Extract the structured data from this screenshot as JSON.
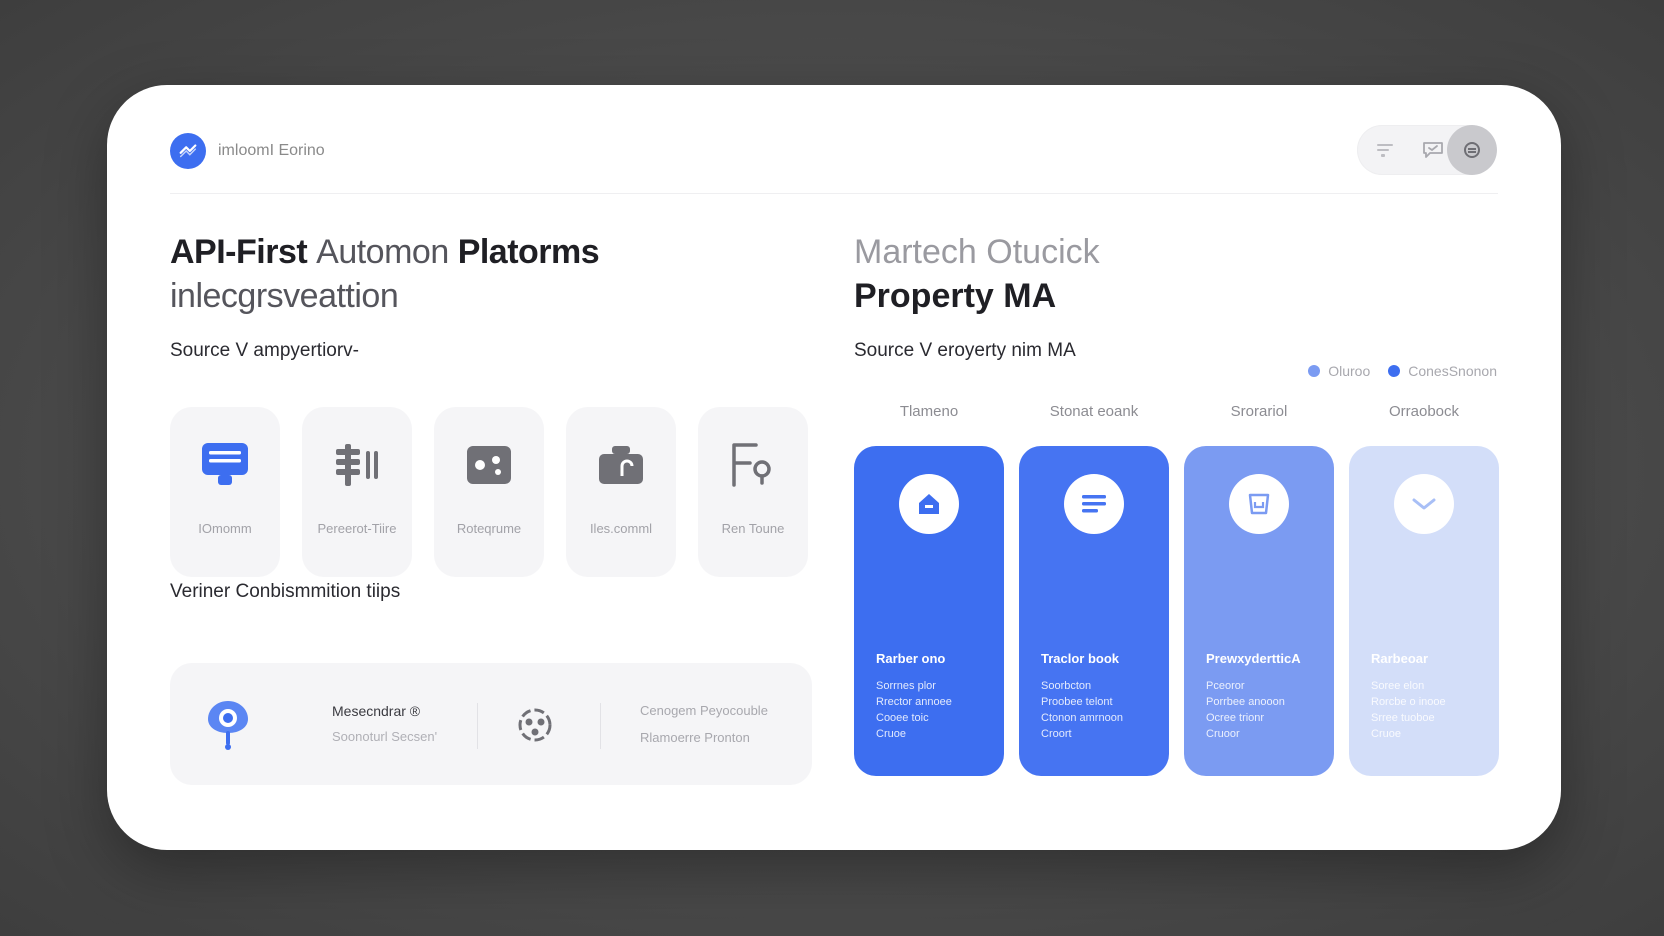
{
  "header": {
    "brand_name": "imloomI Eorino",
    "actions": [
      "list-icon",
      "shield-chat-icon",
      "settings-icon"
    ]
  },
  "left": {
    "title_bold1": "API-First",
    "title_light": "Automon",
    "title_bold2": "Platorms",
    "title_line2": "inlecgrsveattion",
    "source_label": "Source V ampyertiorv-",
    "tiles": [
      {
        "label": "IOmomm",
        "icon": "chat-card-icon",
        "color": "#3d6ef0"
      },
      {
        "label": "Pereerot-Tiire",
        "icon": "server-bars-icon",
        "color": "#707076"
      },
      {
        "label": "Roteqrume",
        "icon": "photo-icon",
        "color": "#707076"
      },
      {
        "label": "Iles.comml",
        "icon": "briefcase-icon",
        "color": "#707076"
      },
      {
        "label": "Ren Toune",
        "icon": "file-search-icon",
        "color": "#707076"
      }
    ],
    "tips_label": "Veriner Conbismmition tiips",
    "tips": {
      "item1_title": "Mesecndrar ®",
      "item1_sub": "Soonoturl Secsen'",
      "item2_title": "Cenogem Peyocouble",
      "item2_sub": "Rlamoerre Pronton"
    }
  },
  "right": {
    "title_line1": "Martech Otucick",
    "title_line2": "Property MA",
    "source_label": "Source V eroyerty nim MA",
    "legend": [
      {
        "label": "Oluroo",
        "color": "#7b9bf2"
      },
      {
        "label": "ConesSnonon",
        "color": "#3d6ef0"
      }
    ],
    "columns": [
      {
        "header": "Tlameno",
        "title": "Rarber ono",
        "icon": "home-icon",
        "color": "#3d6ef0",
        "lines": [
          "Sorrnes plor",
          "Rrector annoee",
          "Cooee toic",
          "Cruoe"
        ]
      },
      {
        "header": "Stonat eoank",
        "title": "Traclor book",
        "icon": "lines-icon",
        "color": "#4674f2",
        "lines": [
          "Soorbcton",
          "Proobee telont",
          "Ctonon amrnoon",
          "Croort"
        ]
      },
      {
        "header": "Srorariol",
        "title": "PrewxydertticA",
        "icon": "cup-icon",
        "color": "#7b9bf2",
        "lines": [
          "Pceoror",
          "Porrbee anooon",
          "Ocree trionr",
          "Cruoor"
        ]
      },
      {
        "header": "Orraobock",
        "title": "Rarbeoar",
        "icon": "chevron-down-icon",
        "color": "#c9d6fb",
        "lines": [
          "Soree elon",
          "Rorcbe o inooe",
          "Srree tuoboe",
          "Cruoe"
        ]
      }
    ]
  }
}
